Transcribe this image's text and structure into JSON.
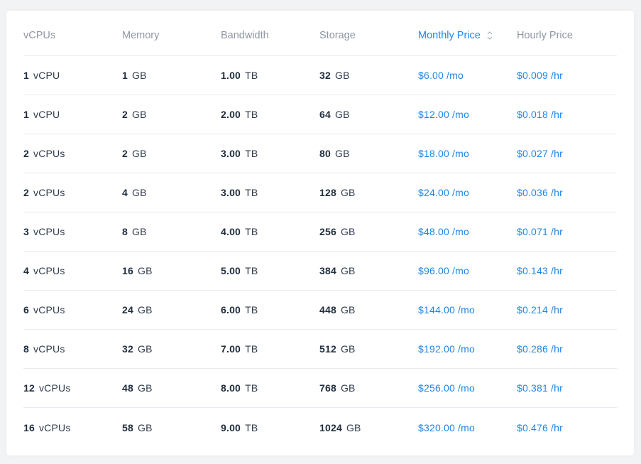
{
  "colors": {
    "accent": "#1f86e8",
    "text": "#1f2d3d",
    "header_text": "#8e96a3",
    "divider": "#e8ebef"
  },
  "headers": [
    "vCPUs",
    "Memory",
    "Bandwidth",
    "Storage",
    "Monthly Price",
    "Hourly Price"
  ],
  "sort": {
    "column": "Monthly Price",
    "icon": "sort-chevron-icon"
  },
  "rows": [
    {
      "vcpu": "1",
      "vcpu_unit": "vCPU",
      "mem": "1",
      "mem_unit": "GB",
      "bw": "1.00",
      "bw_unit": "TB",
      "storage": "32",
      "storage_unit": "GB",
      "monthly": "$6.00",
      "monthly_unit": "/mo",
      "hourly": "$0.009",
      "hourly_unit": "/hr"
    },
    {
      "vcpu": "1",
      "vcpu_unit": "vCPU",
      "mem": "2",
      "mem_unit": "GB",
      "bw": "2.00",
      "bw_unit": "TB",
      "storage": "64",
      "storage_unit": "GB",
      "monthly": "$12.00",
      "monthly_unit": "/mo",
      "hourly": "$0.018",
      "hourly_unit": "/hr"
    },
    {
      "vcpu": "2",
      "vcpu_unit": "vCPUs",
      "mem": "2",
      "mem_unit": "GB",
      "bw": "3.00",
      "bw_unit": "TB",
      "storage": "80",
      "storage_unit": "GB",
      "monthly": "$18.00",
      "monthly_unit": "/mo",
      "hourly": "$0.027",
      "hourly_unit": "/hr"
    },
    {
      "vcpu": "2",
      "vcpu_unit": "vCPUs",
      "mem": "4",
      "mem_unit": "GB",
      "bw": "3.00",
      "bw_unit": "TB",
      "storage": "128",
      "storage_unit": "GB",
      "monthly": "$24.00",
      "monthly_unit": "/mo",
      "hourly": "$0.036",
      "hourly_unit": "/hr"
    },
    {
      "vcpu": "3",
      "vcpu_unit": "vCPUs",
      "mem": "8",
      "mem_unit": "GB",
      "bw": "4.00",
      "bw_unit": "TB",
      "storage": "256",
      "storage_unit": "GB",
      "monthly": "$48.00",
      "monthly_unit": "/mo",
      "hourly": "$0.071",
      "hourly_unit": "/hr"
    },
    {
      "vcpu": "4",
      "vcpu_unit": "vCPUs",
      "mem": "16",
      "mem_unit": "GB",
      "bw": "5.00",
      "bw_unit": "TB",
      "storage": "384",
      "storage_unit": "GB",
      "monthly": "$96.00",
      "monthly_unit": "/mo",
      "hourly": "$0.143",
      "hourly_unit": "/hr"
    },
    {
      "vcpu": "6",
      "vcpu_unit": "vCPUs",
      "mem": "24",
      "mem_unit": "GB",
      "bw": "6.00",
      "bw_unit": "TB",
      "storage": "448",
      "storage_unit": "GB",
      "monthly": "$144.00",
      "monthly_unit": "/mo",
      "hourly": "$0.214",
      "hourly_unit": "/hr"
    },
    {
      "vcpu": "8",
      "vcpu_unit": "vCPUs",
      "mem": "32",
      "mem_unit": "GB",
      "bw": "7.00",
      "bw_unit": "TB",
      "storage": "512",
      "storage_unit": "GB",
      "monthly": "$192.00",
      "monthly_unit": "/mo",
      "hourly": "$0.286",
      "hourly_unit": "/hr"
    },
    {
      "vcpu": "12",
      "vcpu_unit": "vCPUs",
      "mem": "48",
      "mem_unit": "GB",
      "bw": "8.00",
      "bw_unit": "TB",
      "storage": "768",
      "storage_unit": "GB",
      "monthly": "$256.00",
      "monthly_unit": "/mo",
      "hourly": "$0.381",
      "hourly_unit": "/hr"
    },
    {
      "vcpu": "16",
      "vcpu_unit": "vCPUs",
      "mem": "58",
      "mem_unit": "GB",
      "bw": "9.00",
      "bw_unit": "TB",
      "storage": "1024",
      "storage_unit": "GB",
      "monthly": "$320.00",
      "monthly_unit": "/mo",
      "hourly": "$0.476",
      "hourly_unit": "/hr"
    }
  ]
}
